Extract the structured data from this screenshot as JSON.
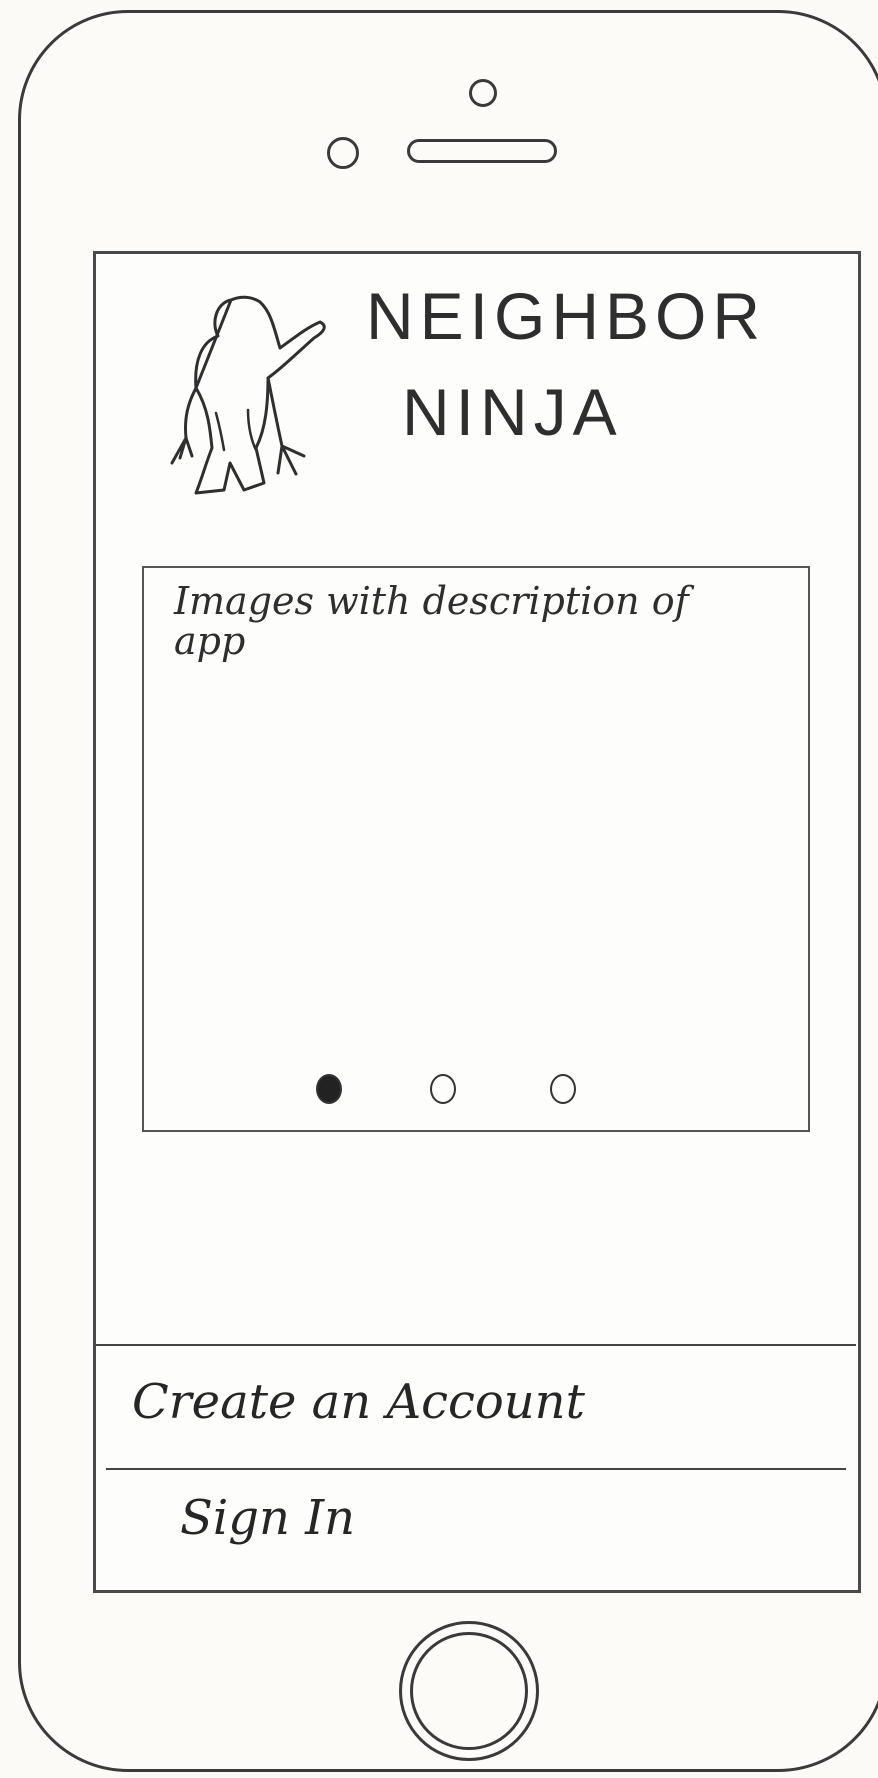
{
  "app": {
    "title_line1": "NEIGHBOR",
    "title_line2": "NINJA",
    "logo_icon": "ninja-icon"
  },
  "carousel": {
    "caption": "Images with description of app",
    "page_count": 3,
    "active_page": 1
  },
  "actions": {
    "create_account_label": "Create an Account",
    "sign_in_label": "Sign In"
  }
}
